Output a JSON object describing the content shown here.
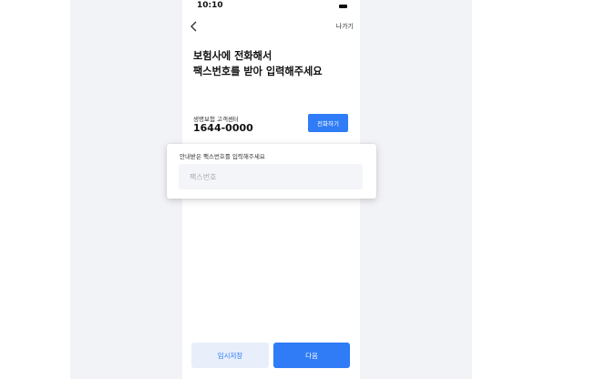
{
  "status_bar": {
    "time": "10:10"
  },
  "header": {
    "back_icon": "chevron-left-icon",
    "action_label": "나가기"
  },
  "title": {
    "line1": "보험사에 전화해서",
    "line2": "팩스번호를 받아 입력해주세요"
  },
  "contact": {
    "center_label": "생명보험 고객센터",
    "phone_number": "1644-0000",
    "call_label": "전화하기"
  },
  "fax_popup": {
    "label": "안내받은 팩스번호를 입력해주세요",
    "input_value": "",
    "input_placeholder": "팩스번호"
  },
  "footer": {
    "save_label": "임시저장",
    "next_label": "다음"
  },
  "colors": {
    "accent": "#2f7cf6",
    "secondary_button_bg": "#e8effb",
    "page_background": "#f2f3f6"
  }
}
